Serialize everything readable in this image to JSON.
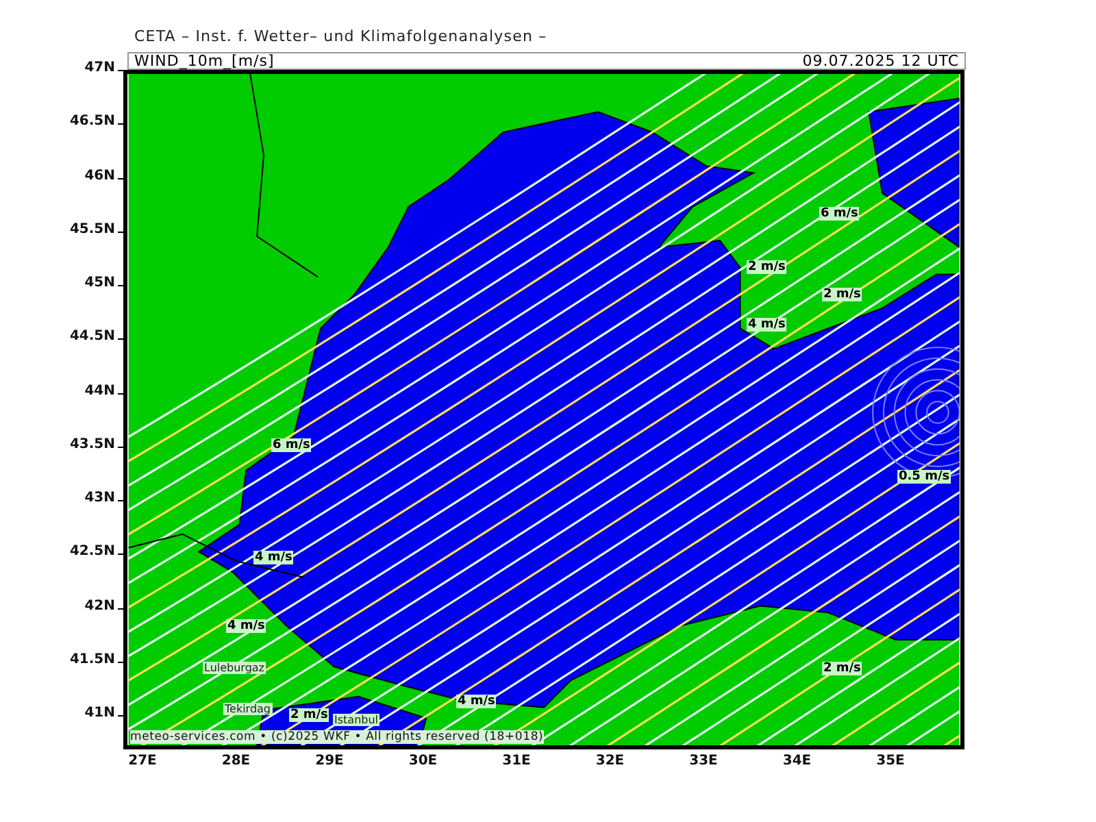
{
  "header": {
    "title": "CETA – Inst. f. Wetter– und Klimafolgenanalysen –"
  },
  "panel": {
    "variable": "WIND_10m_[m/s]",
    "valid_time": "09.07.2025 12 UTC"
  },
  "map": {
    "contour_labels": [
      "6 m/s",
      "2 m/s",
      "2 m/s",
      "4 m/s",
      "0.5 m/s",
      "6 m/s",
      "4 m/s",
      "4 m/s",
      "4 m/s",
      "2 m/s",
      "2 m/s"
    ],
    "place_labels": [
      "Luleburgaz",
      "Tekirdag",
      "Istanbul"
    ],
    "credit": "meteo-services.com • (c)2025 WKF • All rights reserved (18+018)"
  },
  "lat_ticks": [
    "47N",
    "46.5N",
    "46N",
    "45.5N",
    "45N",
    "44.5N",
    "44N",
    "43.5N",
    "43N",
    "42.5N",
    "42N",
    "41.5N",
    "41N"
  ],
  "lon_ticks": [
    "27E",
    "28E",
    "29E",
    "30E",
    "31E",
    "32E",
    "33E",
    "34E",
    "35E"
  ]
}
